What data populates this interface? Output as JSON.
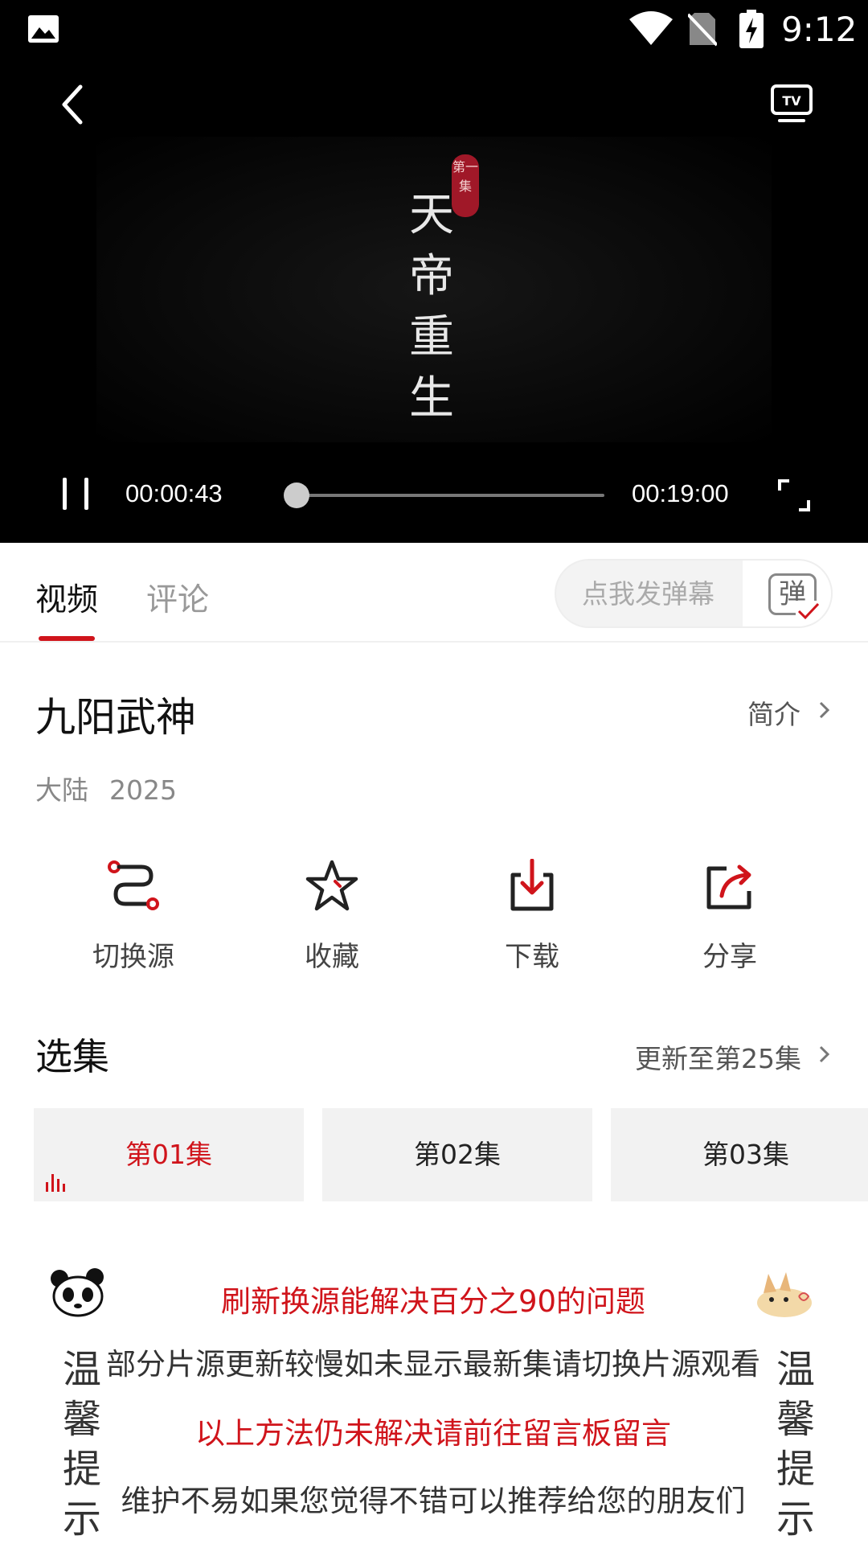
{
  "status_bar": {
    "time": "9:12",
    "icons": [
      "gallery-icon",
      "wifi-icon",
      "no-sim-icon",
      "battery-charging-icon"
    ]
  },
  "player": {
    "title_art": [
      "天",
      "帝",
      "重",
      "生"
    ],
    "seal_text": "第一集",
    "current_time": "00:00:43",
    "total_time": "00:19:00",
    "progress_fraction": 0.038,
    "icons": [
      "back-icon",
      "tv-cast-icon",
      "pause-icon",
      "fullscreen-icon"
    ]
  },
  "tabs": {
    "items": [
      {
        "label": "视频",
        "active": true
      },
      {
        "label": "评论",
        "active": false
      }
    ],
    "danmu_placeholder": "点我发弹幕",
    "danmu_toggle_label": "弹"
  },
  "show": {
    "title": "九阳武神",
    "intro_label": "简介",
    "region": "大陆",
    "year": "2025"
  },
  "actions": [
    {
      "label": "切换源",
      "icon": "switch-source-icon"
    },
    {
      "label": "收藏",
      "icon": "star-icon"
    },
    {
      "label": "下载",
      "icon": "download-icon"
    },
    {
      "label": "分享",
      "icon": "share-icon"
    }
  ],
  "episodes": {
    "title": "选集",
    "update_label": "更新至第25集",
    "items": [
      {
        "label": "第01集",
        "active": true
      },
      {
        "label": "第02集",
        "active": false
      },
      {
        "label": "第03集",
        "active": false
      }
    ]
  },
  "banner": {
    "side_text": [
      "温",
      "馨",
      "提",
      "示"
    ],
    "lines": [
      "刷新换源能解决百分之90的问题",
      "部分片源更新较慢如未显示最新集请切换片源观看",
      "以上方法仍未解决请前往留言板留言",
      "维护不易如果您觉得不错可以推荐给您的朋友们"
    ]
  },
  "colors": {
    "accent": "#d0141b",
    "player_bg": "#000000",
    "episode_bg": "#f2f2f2"
  }
}
